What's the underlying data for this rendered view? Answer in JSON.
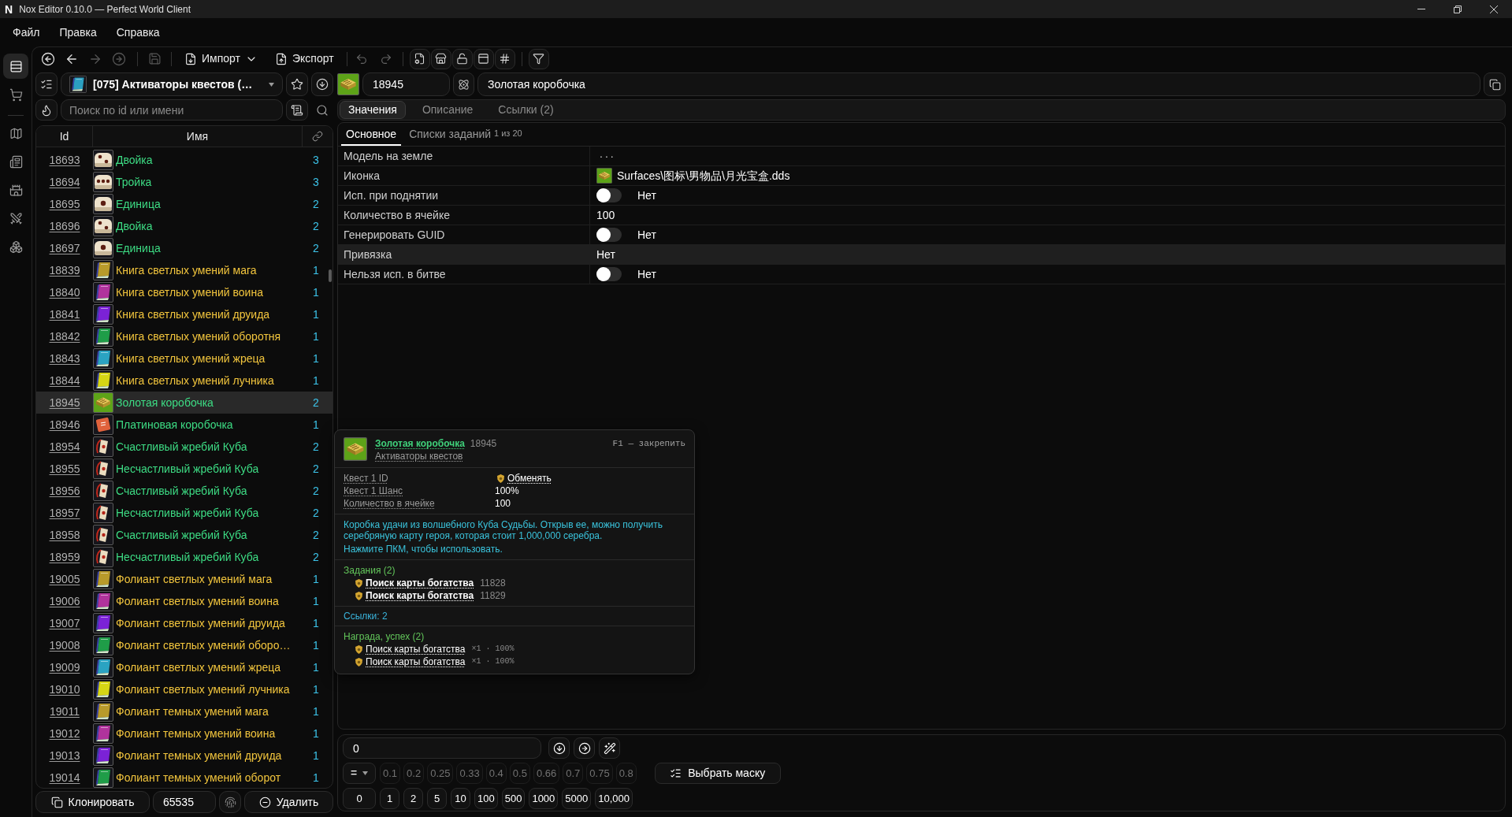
{
  "window": {
    "logo": "N",
    "title": "Nox Editor 0.10.0 — Perfect World Client"
  },
  "menu": [
    "Файл",
    "Правка",
    "Справка"
  ],
  "activity_bar": [
    {
      "selected": true
    },
    {
      "selected": false
    },
    {
      "selected": false
    },
    {
      "selected": false
    },
    {
      "selected": false
    },
    {
      "selected": false
    },
    {
      "selected": false
    }
  ],
  "toolbar": {
    "nav": [
      {
        "disabled": false
      },
      {
        "disabled": false
      },
      {
        "disabled": true
      },
      {
        "disabled": true
      }
    ],
    "save": {
      "disabled": true
    },
    "import": {
      "label": "Импорт"
    },
    "export": {
      "label": "Экспорт"
    },
    "history": [
      {
        "disabled": true
      },
      {
        "disabled": true
      }
    ]
  },
  "category": {
    "label": "[075] Активаторы квестов (…"
  },
  "search": {
    "placeholder": "Поиск по id или имени"
  },
  "list": {
    "columns": [
      "Id",
      "Имя"
    ],
    "rows": [
      {
        "id": "18693",
        "name": "Двойка",
        "count": "3",
        "color": "#3ddc84",
        "icon": {
          "kind": "die2"
        },
        "selected": false
      },
      {
        "id": "18694",
        "name": "Тройка",
        "count": "3",
        "color": "#3ddc84",
        "icon": {
          "kind": "die3"
        },
        "selected": false
      },
      {
        "id": "18695",
        "name": "Единица",
        "count": "2",
        "color": "#3ddc84",
        "icon": {
          "kind": "die1"
        },
        "selected": false
      },
      {
        "id": "18696",
        "name": "Двойка",
        "count": "2",
        "color": "#3ddc84",
        "icon": {
          "kind": "die2"
        },
        "selected": false
      },
      {
        "id": "18697",
        "name": "Единица",
        "count": "2",
        "color": "#3ddc84",
        "icon": {
          "kind": "die1"
        },
        "selected": false
      },
      {
        "id": "18839",
        "name": "Книга светлых умений мага",
        "count": "1",
        "color": "#f2c53d",
        "icon": {
          "kind": "book",
          "color": "#b89a2a"
        },
        "selected": false
      },
      {
        "id": "18840",
        "name": "Книга светлых умений воина",
        "count": "1",
        "color": "#f2c53d",
        "icon": {
          "kind": "book",
          "color": "#b0339c"
        },
        "selected": false
      },
      {
        "id": "18841",
        "name": "Книга светлых умений друида",
        "count": "1",
        "color": "#f2c53d",
        "icon": {
          "kind": "book",
          "color": "#7b22d6"
        },
        "selected": false
      },
      {
        "id": "18842",
        "name": "Книга светлых умений оборотня",
        "count": "1",
        "color": "#f2c53d",
        "icon": {
          "kind": "book",
          "color": "#1f9d48"
        },
        "selected": false
      },
      {
        "id": "18843",
        "name": "Книга светлых умений жреца",
        "count": "1",
        "color": "#f2c53d",
        "icon": {
          "kind": "book",
          "color": "#2aa3c2"
        },
        "selected": false
      },
      {
        "id": "18844",
        "name": "Книга светлых умений лучника",
        "count": "1",
        "color": "#f2c53d",
        "icon": {
          "kind": "book",
          "color": "#d6d614"
        },
        "selected": false
      },
      {
        "id": "18945",
        "name": "Золотая коробочка",
        "count": "2",
        "color": "#3ddc84",
        "icon": {
          "kind": "goldbox"
        },
        "selected": true
      },
      {
        "id": "18946",
        "name": "Платиновая коробочка",
        "count": "1",
        "color": "#3ddc84",
        "icon": {
          "kind": "redbox"
        },
        "selected": false
      },
      {
        "id": "18954",
        "name": "Счастливый жребий Куба",
        "count": "2",
        "color": "#3ddc84",
        "icon": {
          "kind": "ticket"
        },
        "selected": false
      },
      {
        "id": "18955",
        "name": "Несчастливый жребий Куба",
        "count": "2",
        "color": "#3ddc84",
        "icon": {
          "kind": "ticket"
        },
        "selected": false
      },
      {
        "id": "18956",
        "name": "Счастливый жребий Куба",
        "count": "2",
        "color": "#3ddc84",
        "icon": {
          "kind": "ticket"
        },
        "selected": false
      },
      {
        "id": "18957",
        "name": "Несчастливый жребий Куба",
        "count": "2",
        "color": "#3ddc84",
        "icon": {
          "kind": "ticket"
        },
        "selected": false
      },
      {
        "id": "18958",
        "name": "Счастливый жребий Куба",
        "count": "2",
        "color": "#3ddc84",
        "icon": {
          "kind": "ticket"
        },
        "selected": false
      },
      {
        "id": "18959",
        "name": "Несчастливый жребий Куба",
        "count": "2",
        "color": "#3ddc84",
        "icon": {
          "kind": "ticket"
        },
        "selected": false
      },
      {
        "id": "19005",
        "name": "Фолиант светлых умений мага",
        "count": "1",
        "color": "#f2c53d",
        "icon": {
          "kind": "book",
          "color": "#b89a2a"
        },
        "selected": false
      },
      {
        "id": "19006",
        "name": "Фолиант светлых умений воина",
        "count": "1",
        "color": "#f2c53d",
        "icon": {
          "kind": "book",
          "color": "#b0339c"
        },
        "selected": false
      },
      {
        "id": "19007",
        "name": "Фолиант светлых умений друида",
        "count": "1",
        "color": "#f2c53d",
        "icon": {
          "kind": "book",
          "color": "#7b22d6"
        },
        "selected": false
      },
      {
        "id": "19008",
        "name": "Фолиант светлых умений оборо…",
        "count": "1",
        "color": "#f2c53d",
        "icon": {
          "kind": "book",
          "color": "#1f9d48"
        },
        "selected": false
      },
      {
        "id": "19009",
        "name": "Фолиант светлых умений жреца",
        "count": "1",
        "color": "#f2c53d",
        "icon": {
          "kind": "book",
          "color": "#2aa3c2"
        },
        "selected": false
      },
      {
        "id": "19010",
        "name": "Фолиант светлых умений лучника",
        "count": "1",
        "color": "#f2c53d",
        "icon": {
          "kind": "book",
          "color": "#d6d614"
        },
        "selected": false
      },
      {
        "id": "19011",
        "name": "Фолиант темных умений мага",
        "count": "1",
        "color": "#f2c53d",
        "icon": {
          "kind": "book",
          "color": "#b89a2a"
        },
        "selected": false
      },
      {
        "id": "19012",
        "name": "Фолиант темных умений воина",
        "count": "1",
        "color": "#f2c53d",
        "icon": {
          "kind": "book",
          "color": "#b0339c"
        },
        "selected": false
      },
      {
        "id": "19013",
        "name": "Фолиант темных умений друида",
        "count": "1",
        "color": "#f2c53d",
        "icon": {
          "kind": "book",
          "color": "#7b22d6"
        },
        "selected": false
      },
      {
        "id": "19014",
        "name": "Фолиант темных умений оборот",
        "count": "1",
        "color": "#f2c53d",
        "icon": {
          "kind": "book",
          "color": "#1f9d48"
        },
        "selected": false
      }
    ]
  },
  "list_actions": {
    "clone": "Клонировать",
    "number": "65535",
    "delete": "Удалить"
  },
  "item": {
    "id": "18945",
    "name": "Золотая коробочка"
  },
  "tabs": [
    {
      "label": "Значения",
      "selected": true
    },
    {
      "label": "Описание",
      "selected": false
    },
    {
      "label": "Ссылки (2)",
      "selected": false
    }
  ],
  "subtabs": [
    {
      "label": "Основное",
      "selected": true
    },
    {
      "label": "Списки заданий",
      "note": "1 из 20",
      "selected": false
    }
  ],
  "properties": [
    {
      "label": "Модель на земле",
      "kind": "button",
      "value": "...",
      "selected": false
    },
    {
      "label": "Иконка",
      "kind": "file",
      "value": "Surfaces\\图标\\男物品\\月光宝盒.dds",
      "selected": false
    },
    {
      "label": "Исп. при поднятии",
      "kind": "toggle",
      "on": false,
      "value": "Нет",
      "selected": false
    },
    {
      "label": "Количество в ячейке",
      "kind": "text",
      "value": "100",
      "selected": false
    },
    {
      "label": "Генерировать GUID",
      "kind": "toggle",
      "on": false,
      "value": "Нет",
      "selected": false
    },
    {
      "label": "Привязка",
      "kind": "text",
      "value": "Нет",
      "selected": true
    },
    {
      "label": "Нельзя исп. в битве",
      "kind": "toggle",
      "on": false,
      "value": "Нет",
      "selected": false
    }
  ],
  "tooltip": {
    "name": "Золотая коробочка",
    "id": "18945",
    "category": "Активаторы квестов",
    "hint": "F1 — закрепить",
    "stats": [
      {
        "label": "Квест 1 ID",
        "kind": "link",
        "value": "Обменять"
      },
      {
        "label": "Квест 1 Шанс",
        "kind": "text",
        "value": "100%"
      },
      {
        "label": "Количество в ячейке",
        "kind": "text",
        "value": "100"
      }
    ],
    "description": [
      "Коробка удачи из волшебного Куба Судьбы. Открыв ее, можно получить серебряную карту героя, которая стоит 1,000,000 серебра.",
      "Нажмите ПКМ, чтобы использовать."
    ],
    "quests": {
      "title": "Задания (2)",
      "items": [
        {
          "name": "Поиск карты богатства",
          "id": "11828"
        },
        {
          "name": "Поиск карты богатства",
          "id": "11829"
        }
      ]
    },
    "links": "Ссылки: 2",
    "rewards": {
      "title": "Награда, успех (2)",
      "items": [
        {
          "name": "Поиск карты богатства",
          "detail": "×1 · 100%"
        },
        {
          "name": "Поиск карты богатства",
          "detail": "×1 · 100%"
        }
      ]
    }
  },
  "value_panel": {
    "input": {
      "value": "0"
    },
    "operator": {
      "value": "="
    },
    "factors": [
      {
        "label": "0.1",
        "disabled": true
      },
      {
        "label": "0.2",
        "disabled": true
      },
      {
        "label": "0.25",
        "disabled": true
      },
      {
        "label": "0.33",
        "disabled": true
      },
      {
        "label": "0.4",
        "disabled": true
      },
      {
        "label": "0.5",
        "disabled": true
      },
      {
        "label": "0.66",
        "disabled": true
      },
      {
        "label": "0.7",
        "disabled": true
      },
      {
        "label": "0.75",
        "disabled": true
      },
      {
        "label": "0.8",
        "disabled": true
      }
    ],
    "mask_button": {
      "label": "Выбрать маску"
    },
    "amounts": [
      {
        "label": "0",
        "disabled": false
      },
      {
        "label": "1",
        "disabled": false
      },
      {
        "label": "2",
        "disabled": false
      },
      {
        "label": "5",
        "disabled": false
      },
      {
        "label": "10",
        "disabled": false
      },
      {
        "label": "100",
        "disabled": false
      },
      {
        "label": "500",
        "disabled": false
      },
      {
        "label": "1000",
        "disabled": false
      },
      {
        "label": "5000",
        "disabled": false
      },
      {
        "label": "10,000",
        "disabled": false
      }
    ]
  }
}
